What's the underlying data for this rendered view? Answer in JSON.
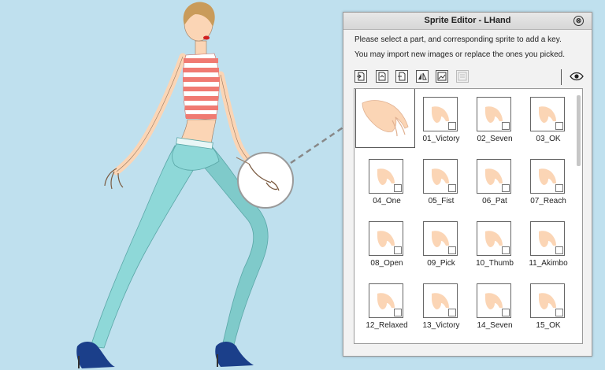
{
  "panel": {
    "title": "Sprite Editor - LHand",
    "close_glyph": "⊗",
    "instruction_line1": "Please select a part, and corresponding sprite to add a key.",
    "instruction_line2": "You may import new images or replace the ones you picked."
  },
  "toolbar": {
    "buttons": [
      "import-icon",
      "replace-icon",
      "reset-icon",
      "flip-icon",
      "image-editor-icon",
      "disabled-tool-icon"
    ],
    "eye_icon": "eye-icon"
  },
  "sprites": [
    {
      "label": "01_Victory"
    },
    {
      "label": "02_Seven"
    },
    {
      "label": "03_OK"
    },
    {
      "label": "04_One"
    },
    {
      "label": "05_Fist"
    },
    {
      "label": "06_Pat"
    },
    {
      "label": "07_Reach"
    },
    {
      "label": "08_Open"
    },
    {
      "label": "09_Pick"
    },
    {
      "label": "10_Thumb"
    },
    {
      "label": "11_Akimbo"
    },
    {
      "label": "12_Relaxed"
    },
    {
      "label": "13_Victory"
    },
    {
      "label": "14_Seven"
    },
    {
      "label": "15_OK"
    }
  ],
  "colors": {
    "background": "#bfe0ee",
    "skin": "#fbd5b5",
    "shirt_stripe": "#f07a72",
    "jeans": "#8ed8d8",
    "hair": "#c99b5a"
  }
}
